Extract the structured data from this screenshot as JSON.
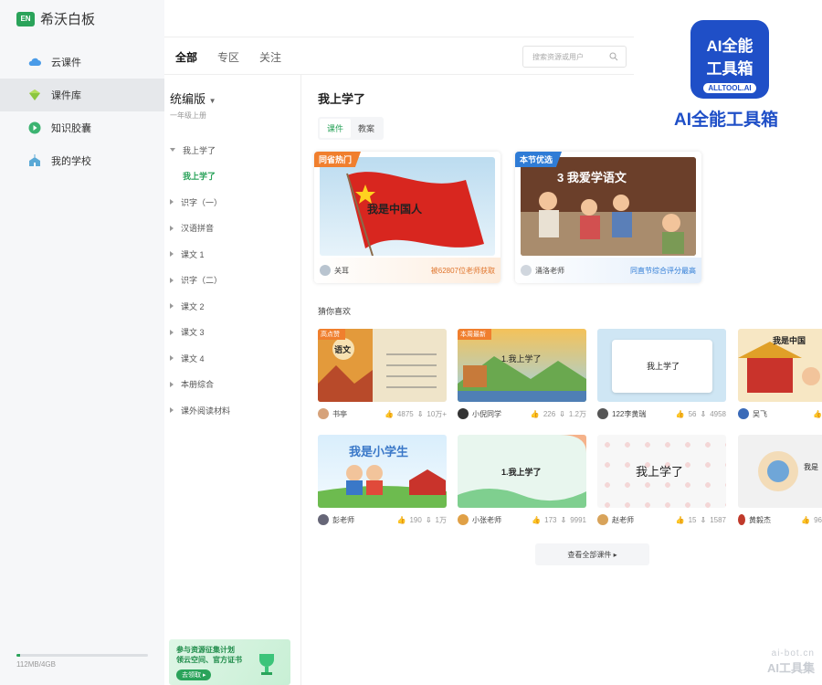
{
  "app": {
    "logo_text": "EN",
    "name": "希沃白板"
  },
  "sidebar": {
    "items": [
      {
        "label": "云课件",
        "icon": "cloud-icon",
        "active": false
      },
      {
        "label": "课件库",
        "icon": "courseware-library-icon",
        "active": true
      },
      {
        "label": "知识胶囊",
        "icon": "capsule-play-icon",
        "active": false
      },
      {
        "label": "我的学校",
        "icon": "school-icon",
        "active": false
      }
    ],
    "storage": {
      "text": "112MB/4GB",
      "used_fraction": 0.027
    }
  },
  "topbar": {
    "tabs": [
      "全部",
      "专区",
      "关注"
    ],
    "active_tab": "全部",
    "search_placeholder": "搜索资源或用户"
  },
  "tree": {
    "edition": "统编版",
    "grade": "一年级上册",
    "items": [
      {
        "label": "我上学了",
        "expanded": true
      },
      {
        "label": "我上学了",
        "sub": true
      },
      {
        "label": "识字（一）"
      },
      {
        "label": "汉语拼音"
      },
      {
        "label": "课文 1"
      },
      {
        "label": "识字（二）"
      },
      {
        "label": "课文 2"
      },
      {
        "label": "课文 3"
      },
      {
        "label": "课文 4"
      },
      {
        "label": "本册综合"
      },
      {
        "label": "课外阅读材料"
      }
    ],
    "promo": {
      "line1": "参与资源征集计划",
      "line2": "领云空间、官方证书",
      "button": "去领取 ▸"
    }
  },
  "main": {
    "title": "我上学了",
    "subtabs": [
      "课件",
      "教案"
    ],
    "featured": [
      {
        "tag": "同省热门",
        "image_text": "我是中国人",
        "author": "关耳",
        "note": "被62807位老师获取",
        "accent": "#f07f2e"
      },
      {
        "tag": "本节优选",
        "image_text": "3 我爱学语文",
        "author": "涌洛老师",
        "note": "同直节综合评分最高",
        "accent": "#2f7cd6"
      }
    ],
    "guess_title": "猜你喜欢",
    "cards": [
      {
        "tag": "高点赞",
        "thumb_text": "语文",
        "name": "书亭",
        "likes": "4875",
        "downloads": "10万+"
      },
      {
        "tag": "本周最新",
        "thumb_text": "1.我上学了",
        "name": "小倪同学",
        "likes": "226",
        "downloads": "1.2万"
      },
      {
        "tag": "",
        "thumb_text": "我上学了",
        "name": "122李黄瑞",
        "likes": "56",
        "downloads": "4958"
      },
      {
        "tag": "",
        "thumb_text": "我是中国",
        "name": "吴飞",
        "likes": "",
        "downloads": ""
      },
      {
        "tag": "",
        "thumb_text": "我是小学生",
        "name": "彭老师",
        "likes": "190",
        "downloads": "1万"
      },
      {
        "tag": "",
        "thumb_text": "1.我上学了",
        "name": "小张老师",
        "likes": "173",
        "downloads": "9991"
      },
      {
        "tag": "",
        "thumb_text": "我上学了",
        "name": "赵老师",
        "likes": "15",
        "downloads": "1587"
      },
      {
        "tag": "",
        "thumb_text": "我是",
        "name": "黄毅杰",
        "likes": "96",
        "downloads": ""
      }
    ],
    "more_button": "查看全部课件 ▸"
  },
  "overlay": {
    "logo_line1": "AI全能",
    "logo_line2": "工具箱",
    "logo_badge": "ALLTOOL.AI",
    "name": "AI全能工具箱",
    "watermark_url": "ai-bot.cn",
    "watermark_name": "AI工具集"
  },
  "colors": {
    "accent_green": "#2aa35a",
    "tag_orange": "#f07f2e",
    "brand_blue": "#1f4fc7"
  }
}
